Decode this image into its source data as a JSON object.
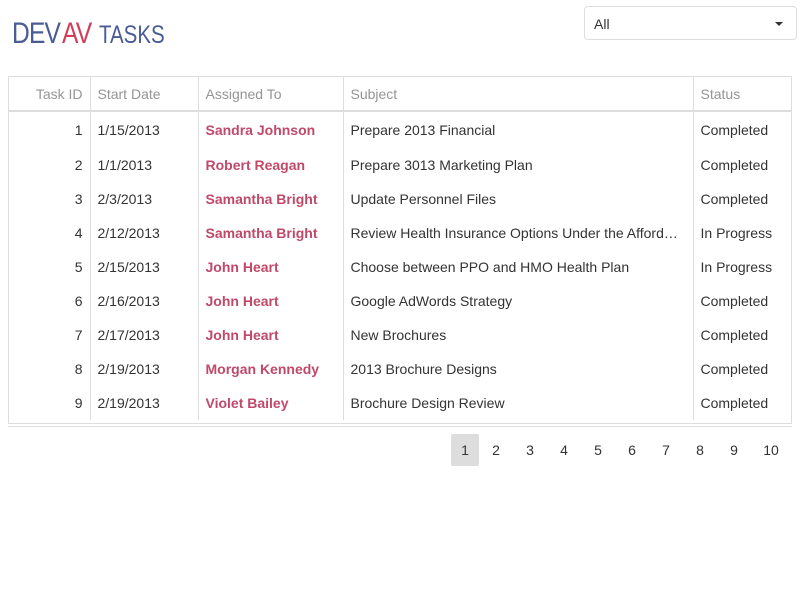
{
  "logo": {
    "dev": "DEV",
    "av": "AV",
    "tasks": "TASKS"
  },
  "filter": {
    "selected": "All"
  },
  "grid": {
    "columns": [
      "Task ID",
      "Start Date",
      "Assigned To",
      "Subject",
      "Status"
    ],
    "rows": [
      {
        "id": "1",
        "start": "1/15/2013",
        "assigned": "Sandra Johnson",
        "subject": "Prepare 2013 Financial",
        "status": "Completed"
      },
      {
        "id": "2",
        "start": "1/1/2013",
        "assigned": "Robert Reagan",
        "subject": "Prepare 3013 Marketing Plan",
        "status": "Completed"
      },
      {
        "id": "3",
        "start": "2/3/2013",
        "assigned": "Samantha Bright",
        "subject": "Update Personnel Files",
        "status": "Completed"
      },
      {
        "id": "4",
        "start": "2/12/2013",
        "assigned": "Samantha Bright",
        "subject": "Review Health Insurance Options Under the Affordable Care Act",
        "status": "In Progress"
      },
      {
        "id": "5",
        "start": "2/15/2013",
        "assigned": "John Heart",
        "subject": "Choose between PPO and HMO Health Plan",
        "status": "In Progress"
      },
      {
        "id": "6",
        "start": "2/16/2013",
        "assigned": "John Heart",
        "subject": "Google AdWords Strategy",
        "status": "Completed"
      },
      {
        "id": "7",
        "start": "2/17/2013",
        "assigned": "John Heart",
        "subject": "New Brochures",
        "status": "Completed"
      },
      {
        "id": "8",
        "start": "2/19/2013",
        "assigned": "Morgan Kennedy",
        "subject": "2013 Brochure Designs",
        "status": "Completed"
      },
      {
        "id": "9",
        "start": "2/19/2013",
        "assigned": "Violet Bailey",
        "subject": "Brochure Design Review",
        "status": "Completed"
      }
    ]
  },
  "pager": {
    "pages": [
      "1",
      "2",
      "3",
      "4",
      "5",
      "6",
      "7",
      "8",
      "9",
      "10"
    ],
    "current": "1"
  },
  "colors": {
    "brand": "#4a5c95",
    "accent": "#d13e5a",
    "assignee": "#c0496a"
  }
}
